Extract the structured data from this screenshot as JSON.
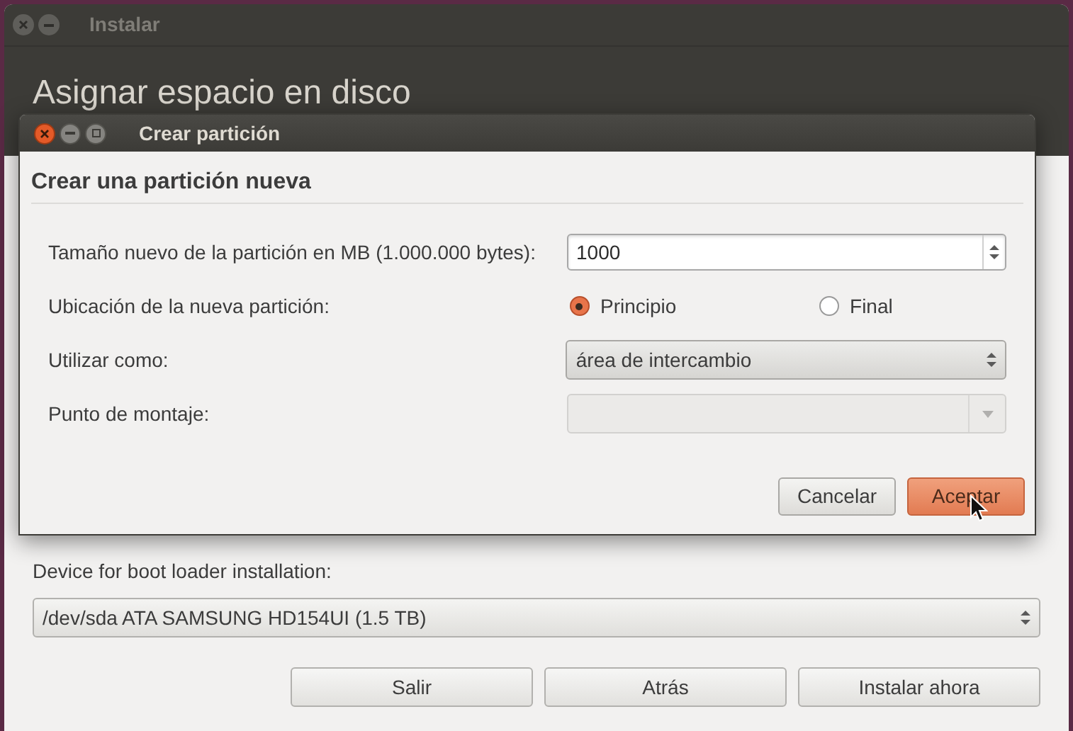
{
  "window": {
    "title": "Instalar",
    "heading": "Asignar espacio en disco"
  },
  "dialog": {
    "title": "Crear partición",
    "heading": "Crear una partición nueva",
    "fields": [
      {
        "kind": "spin",
        "label": "Tamaño nuevo de la partición en MB (1.000.000 bytes):",
        "value": "1000"
      },
      {
        "kind": "radio",
        "label": "Ubicación de la nueva partición:",
        "options": [
          {
            "label": "Principio",
            "selected": true
          },
          {
            "label": "Final",
            "selected": false
          }
        ]
      },
      {
        "kind": "combo",
        "label": "Utilizar como:",
        "value": "área de intercambio",
        "disabled": false
      },
      {
        "kind": "combo",
        "label": "Punto de montaje:",
        "disabled": true
      }
    ],
    "buttons": [
      {
        "label": "Cancelar",
        "default": false
      },
      {
        "label": "Aceptar",
        "default": true
      }
    ]
  },
  "boot_loader": {
    "label": "Device for boot loader installation:",
    "value": "/dev/sda ATA SAMSUNG HD154UI (1.5 TB)"
  },
  "buttons": [
    "Salir",
    "Atrás",
    "Instalar ahora"
  ]
}
